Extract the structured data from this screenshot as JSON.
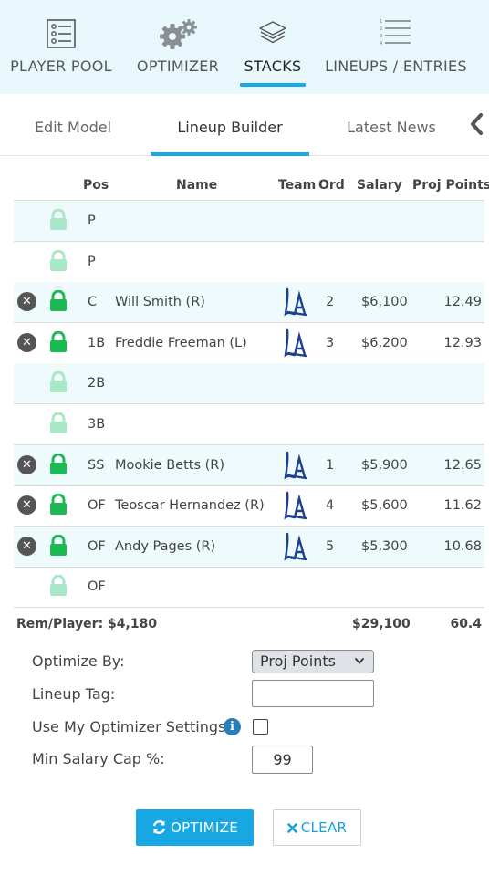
{
  "nav": {
    "items": [
      {
        "label": "PLAYER POOL",
        "icon": "roster-list-icon"
      },
      {
        "label": "OPTIMIZER",
        "icon": "gears-icon"
      },
      {
        "label": "STACKS",
        "icon": "layers-icon"
      },
      {
        "label": "LINEUPS / ENTRIES",
        "icon": "numbered-list-icon"
      }
    ],
    "active": "STACKS"
  },
  "subtabs": {
    "items": [
      "Edit Model",
      "Lineup Builder",
      "Latest News"
    ],
    "active": "Lineup Builder"
  },
  "table": {
    "headers": {
      "pos": "Pos",
      "name": "Name",
      "team": "Team",
      "ord": "Ord",
      "salary": "Salary",
      "proj": "Proj Points"
    },
    "rows": [
      {
        "pos": "P",
        "name": "",
        "team": "",
        "ord": "",
        "salary": "",
        "proj": "",
        "filled": false
      },
      {
        "pos": "P",
        "name": "",
        "team": "",
        "ord": "",
        "salary": "",
        "proj": "",
        "filled": false
      },
      {
        "pos": "C",
        "name": "Will Smith (R)",
        "team": "LA",
        "ord": "2",
        "salary": "$6,100",
        "proj": "12.49",
        "filled": true
      },
      {
        "pos": "1B",
        "name": "Freddie Freeman (L)",
        "team": "LA",
        "ord": "3",
        "salary": "$6,200",
        "proj": "12.93",
        "filled": true
      },
      {
        "pos": "2B",
        "name": "",
        "team": "",
        "ord": "",
        "salary": "",
        "proj": "",
        "filled": false
      },
      {
        "pos": "3B",
        "name": "",
        "team": "",
        "ord": "",
        "salary": "",
        "proj": "",
        "filled": false
      },
      {
        "pos": "SS",
        "name": "Mookie Betts (R)",
        "team": "LA",
        "ord": "1",
        "salary": "$5,900",
        "proj": "12.65",
        "filled": true
      },
      {
        "pos": "OF",
        "name": "Teoscar Hernandez (R)",
        "team": "LA",
        "ord": "4",
        "salary": "$5,600",
        "proj": "11.62",
        "filled": true
      },
      {
        "pos": "OF",
        "name": "Andy Pages (R)",
        "team": "LA",
        "ord": "5",
        "salary": "$5,300",
        "proj": "10.68",
        "filled": true
      },
      {
        "pos": "OF",
        "name": "",
        "team": "",
        "ord": "",
        "salary": "",
        "proj": "",
        "filled": false
      }
    ],
    "totals": {
      "rem_label": "Rem/Player: $4,180",
      "salary": "$29,100",
      "proj": "60.4"
    }
  },
  "form": {
    "optimize_by_label": "Optimize By:",
    "optimize_by_value": "Proj Points",
    "lineup_tag_label": "Lineup Tag:",
    "lineup_tag_value": "",
    "use_settings_label": "Use My Optimizer Settings",
    "use_settings_checked": false,
    "min_salary_label": "Min Salary Cap %:",
    "min_salary_value": "99"
  },
  "buttons": {
    "optimize": "OPTIMIZE",
    "clear": "CLEAR"
  },
  "colors": {
    "accent": "#1aa9e6",
    "lock_active": "#1db954",
    "lock_inactive": "#a9e8c6",
    "row_tint": "#eefafc",
    "team_logo": "#1d3f8f"
  }
}
